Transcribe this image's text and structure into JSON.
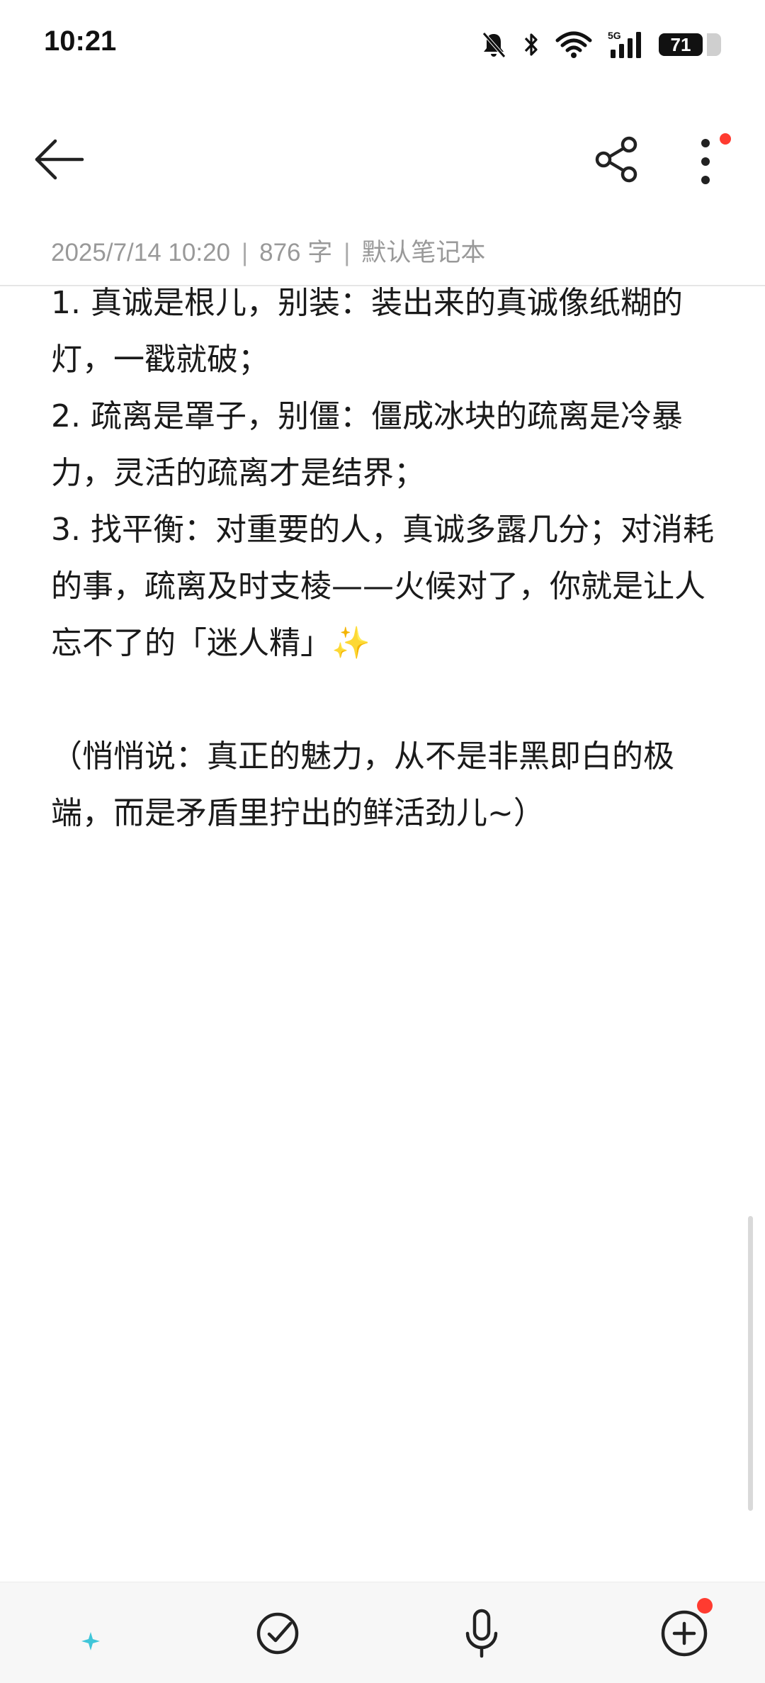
{
  "status_bar": {
    "time": "10:21",
    "battery_level": "71",
    "network_label": "5G",
    "icons": [
      "mute-bell-icon",
      "bluetooth-icon",
      "wifi-icon",
      "cellular-5g-icon",
      "battery-icon"
    ]
  },
  "toolbar": {
    "icons": [
      "back-arrow-icon",
      "share-icon",
      "more-vertical-icon"
    ],
    "more_has_badge": true,
    "badge_color": "#ff3b30"
  },
  "meta": {
    "date": "2025/7/14 10:20",
    "separator": "|",
    "word_count": "876 字",
    "notebook": "默认笔记本"
  },
  "note": {
    "paragraphs": [
      "1. 真诚是根儿，别装：装出来的真诚像纸糊的灯，一戳就破；",
      "2. 疏离是罩子，别僵：僵成冰块的疏离是冷暴力，灵活的疏离才是结界；",
      "3. 找平衡：对重要的人，真诚多露几分；对消耗的事，疏离及时支棱——火候对了，你就是让人忘不了的「迷人精」",
      "",
      "（悄悄说：真正的魅力，从不是非黑即白的极端，而是矛盾里拧出的鲜活劲儿~）"
    ],
    "emoji": "✨"
  },
  "bottom_bar": {
    "icons": [
      "ai-format-icon",
      "checklist-icon",
      "microphone-icon",
      "add-circle-icon"
    ],
    "add_has_badge": true
  }
}
